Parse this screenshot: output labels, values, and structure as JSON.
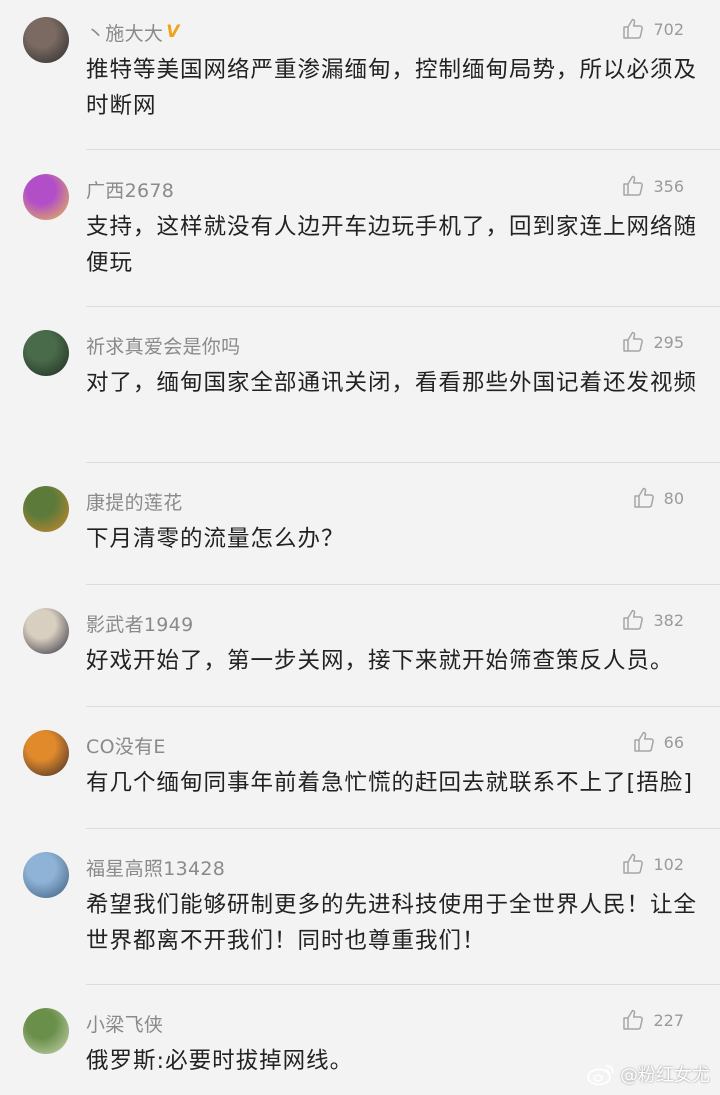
{
  "comments": [
    {
      "username": "丶施大大",
      "verified_badge": "V",
      "likes": "702",
      "text": "推特等美国网络严重渗漏缅甸，控制缅甸局势，所以必须及时断网",
      "avatar_colors": [
        "#7a6a62",
        "#2a2a2a"
      ]
    },
    {
      "username": "广西2678",
      "likes": "356",
      "text": "支持，这样就没有人边开车边玩手机了，回到家连上网络随便玩",
      "avatar_colors": [
        "#b24fc8",
        "#e8c14a"
      ]
    },
    {
      "username": "祈求真爱会是你吗",
      "likes": "295",
      "text": "对了，缅甸国家全部通讯关闭，看看那些外国记着还发视频",
      "avatar_colors": [
        "#4a6b4a",
        "#1b2b22"
      ]
    },
    {
      "username": "康提的莲花",
      "likes": "80",
      "text": "下月清零的流量怎么办？",
      "avatar_colors": [
        "#5c7a3a",
        "#d08a2e"
      ]
    },
    {
      "username": "影武者1949",
      "likes": "382",
      "text": "好戏开始了，第一步关网，接下来就开始筛查策反人员。",
      "avatar_colors": [
        "#d9cfc0",
        "#2b2b3a"
      ]
    },
    {
      "username": "CO没有E",
      "likes": "66",
      "text": "有几个缅甸同事年前着急忙慌的赶回去就联系不上了[捂脸]",
      "avatar_colors": [
        "#e08a2c",
        "#3a2a2a"
      ]
    },
    {
      "username": "福星高照13428",
      "likes": "102",
      "text": "希望我们能够研制更多的先进科技使用于全世界人民！让全世界都离不开我们！同时也尊重我们！",
      "avatar_colors": [
        "#8fb3d6",
        "#3d5a7a"
      ]
    },
    {
      "username": "小梁飞侠",
      "likes": "227",
      "text": "俄罗斯:必要时拔掉网线。",
      "avatar_colors": [
        "#6a8f4a",
        "#c9d6b0"
      ]
    }
  ],
  "watermark": {
    "text": "@粉红女尤"
  },
  "colors": {
    "background": "#f3f3f3",
    "username": "#8a8a8a",
    "body_text": "#222222",
    "divider": "#dcdcdc",
    "verified": "#f0a21a"
  },
  "icons": {
    "like": "thumbs-up-outline-icon",
    "watermark": "weibo-logo-icon"
  }
}
